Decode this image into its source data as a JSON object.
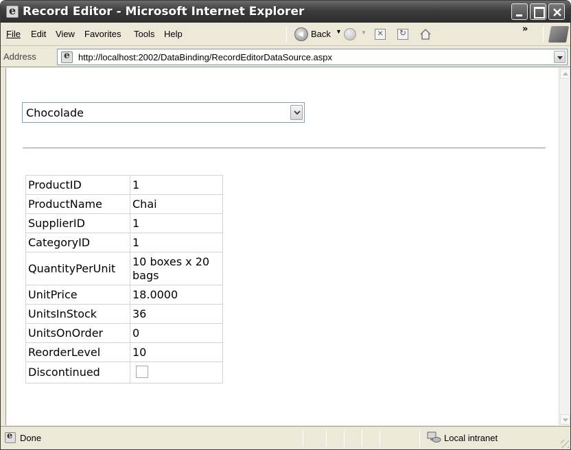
{
  "window": {
    "title": "Record Editor - Microsoft Internet Explorer"
  },
  "menu": {
    "items": [
      "File",
      "Edit",
      "View",
      "Favorites",
      "Tools",
      "Help"
    ],
    "back_label": "Back",
    "more": "»"
  },
  "address": {
    "label": "Address",
    "url": "http://localhost:2002/DataBinding/RecordEditorDataSource.aspx"
  },
  "product_select": {
    "selected": "Chocolade"
  },
  "details": {
    "rows": [
      {
        "field": "ProductID",
        "value": "1"
      },
      {
        "field": "ProductName",
        "value": "Chai"
      },
      {
        "field": "SupplierID",
        "value": "1"
      },
      {
        "field": "CategoryID",
        "value": "1"
      },
      {
        "field": "QuantityPerUnit",
        "value": "10 boxes x 20 bags"
      },
      {
        "field": "UnitPrice",
        "value": "18.0000"
      },
      {
        "field": "UnitsInStock",
        "value": "36"
      },
      {
        "field": "UnitsOnOrder",
        "value": "0"
      },
      {
        "field": "ReorderLevel",
        "value": "10"
      },
      {
        "field": "Discontinued",
        "value": ""
      }
    ],
    "discontinued_checked": false
  },
  "status": {
    "text": "Done",
    "zone": "Local intranet"
  },
  "icons": {
    "title": "ie-icon",
    "back": "back-arrow-icon",
    "forward": "forward-arrow-icon",
    "stop": "stop-icon",
    "refresh": "refresh-icon",
    "home": "home-icon",
    "page": "page-icon",
    "zone": "intranet-icon"
  }
}
